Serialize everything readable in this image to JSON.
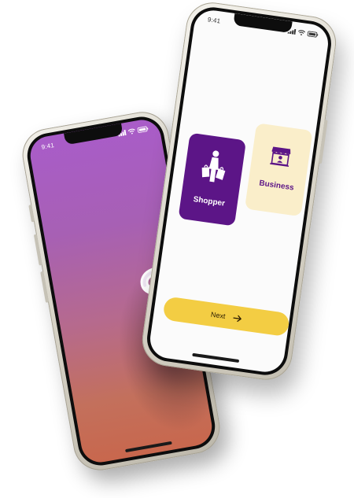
{
  "splash_phone": {
    "status_time": "9:41",
    "logo_icon": "s-logo-icon",
    "gradient_colors": [
      "#a95cc9",
      "#b66a8d",
      "#c8674d"
    ]
  },
  "role_phone": {
    "status_time": "9:41",
    "options": [
      {
        "label": "Shopper",
        "icon": "shopper-bags-icon",
        "background": "#5c1587",
        "text_color": "#ffffff"
      },
      {
        "label": "Business",
        "icon": "storefront-icon",
        "background": "#faeeca",
        "text_color": "#5c1587"
      }
    ],
    "next_button": {
      "label": "Next",
      "icon": "arrow-right-icon",
      "background": "#f3cd43"
    }
  }
}
